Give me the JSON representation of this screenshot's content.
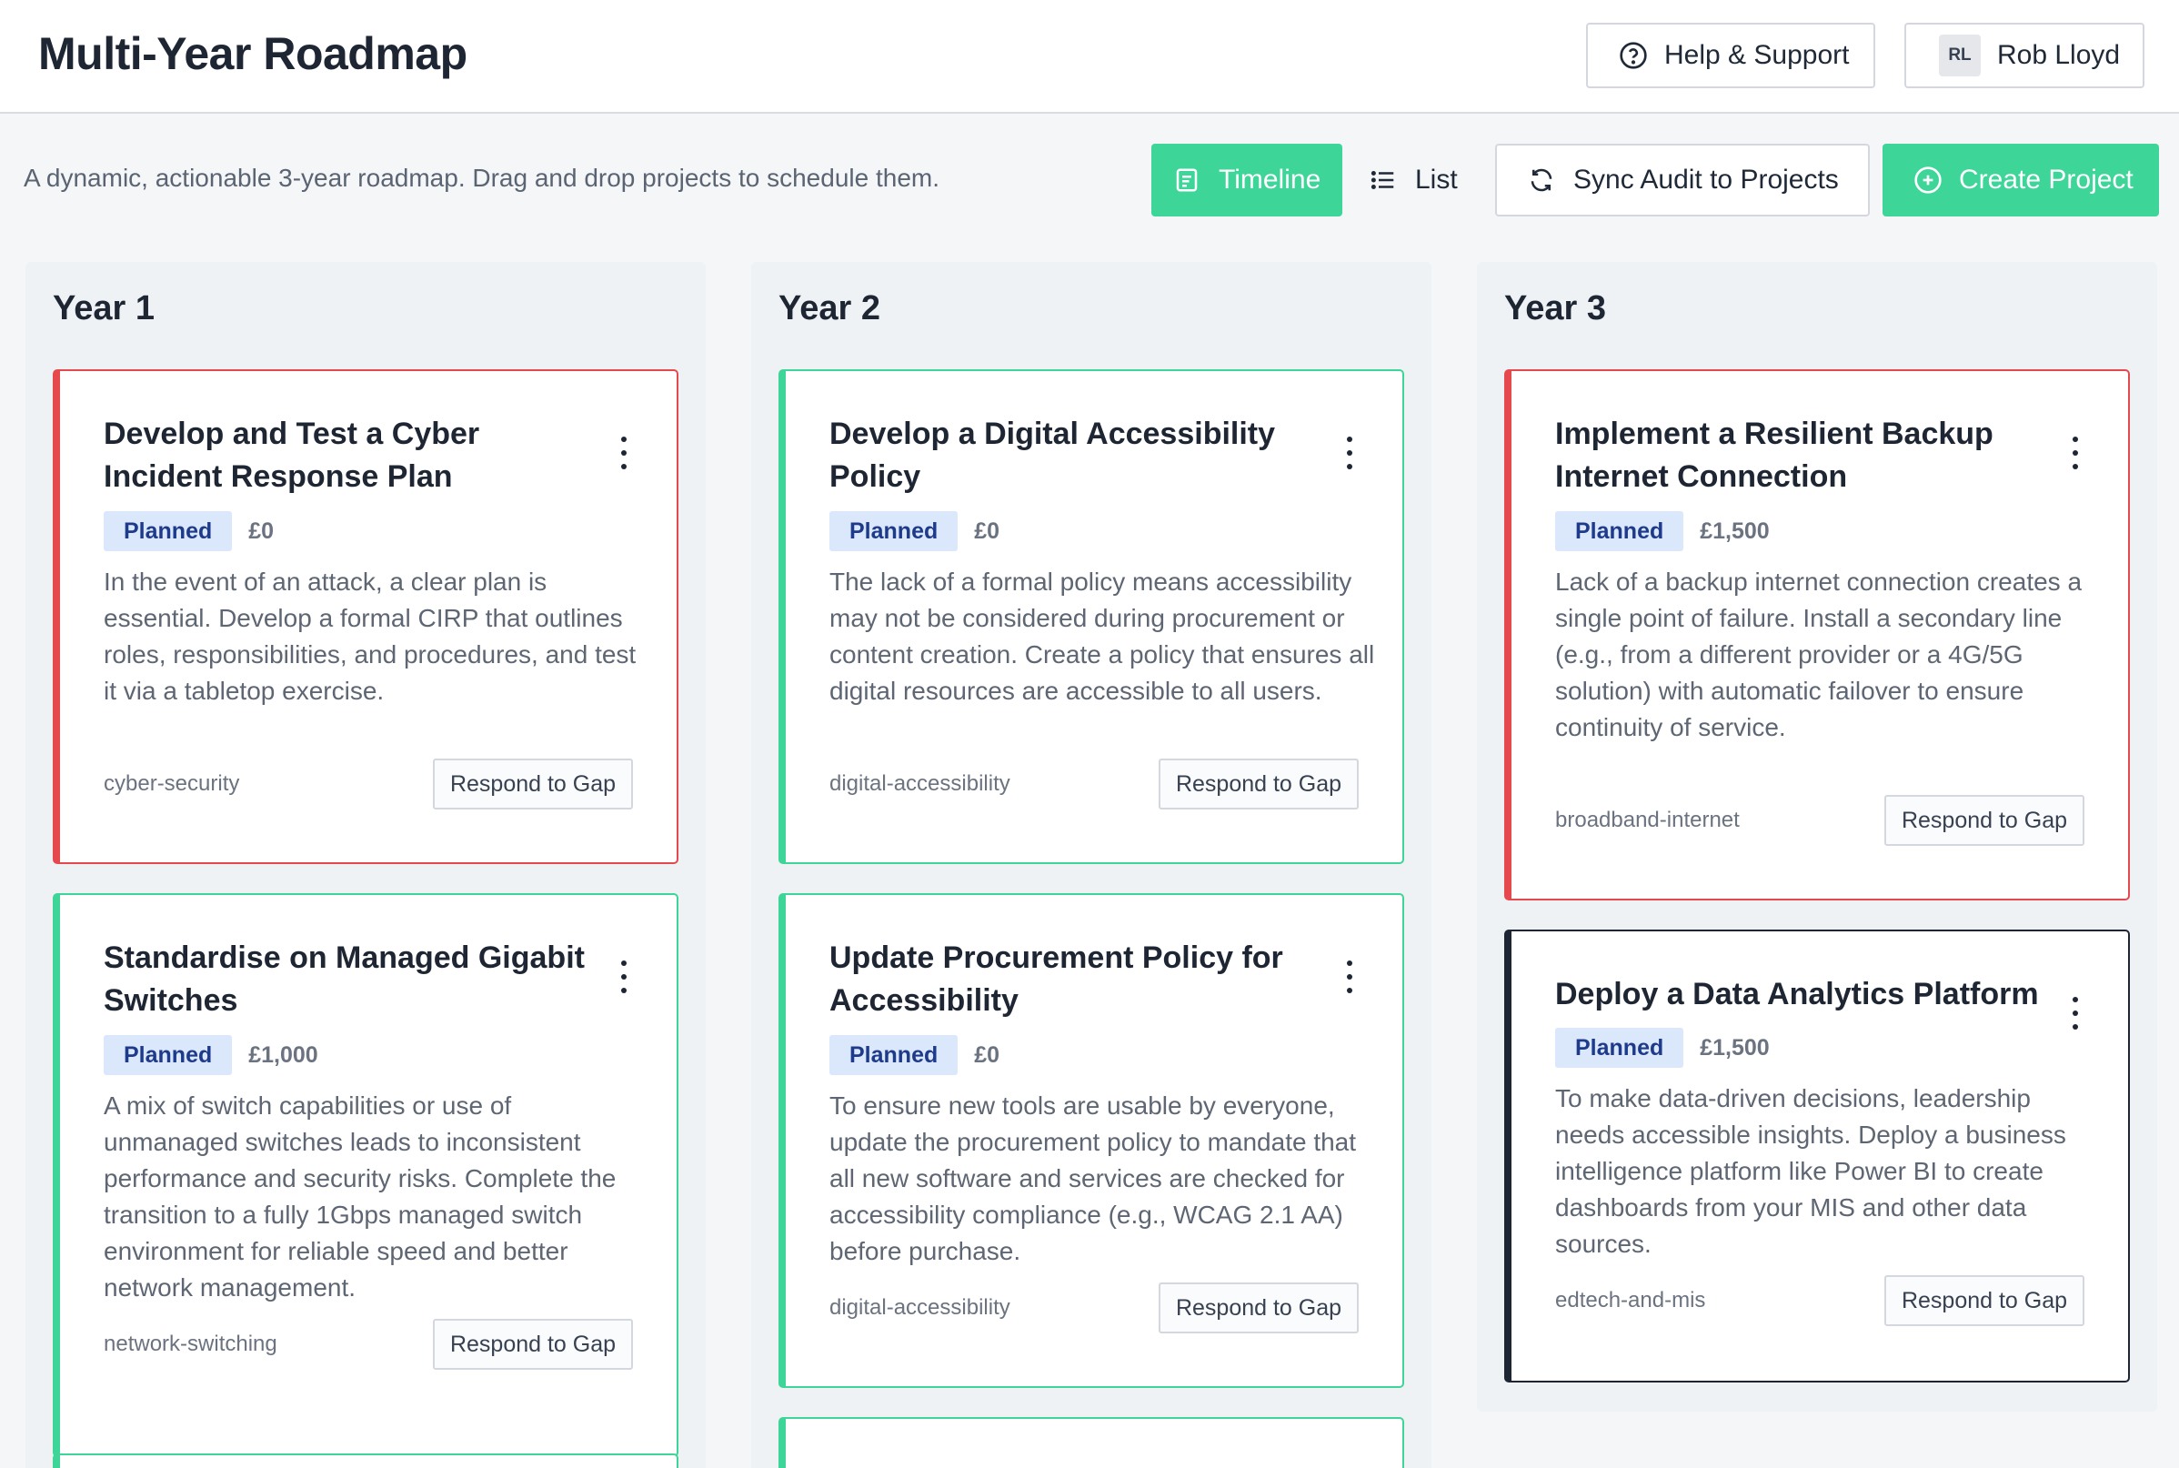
{
  "header": {
    "title": "Multi-Year Roadmap",
    "help_label": "Help & Support",
    "user_initials": "RL",
    "user_name": "Rob Lloyd"
  },
  "toolbar": {
    "description": "A dynamic, actionable 3-year roadmap. Drag and drop projects to schedule them.",
    "timeline_label": "Timeline",
    "list_label": "List",
    "sync_label": "Sync Audit to Projects",
    "create_label": "Create Project"
  },
  "colors": {
    "accent": "#3dd598",
    "high_priority": "#e5484d",
    "dark": "#1e2533",
    "badge_bg": "#dbe7fb"
  },
  "columns": [
    {
      "title": "Year 1",
      "cards": [
        {
          "title": "Develop and Test a Cyber Incident Response Plan",
          "status": "Planned",
          "cost": "£0",
          "description": "In the event of an attack, a clear plan is essential. Develop a formal CIRP that outlines roles, responsibilities, and procedures, and test it via a tabletop exercise.",
          "tag": "cyber-security",
          "action": "Respond to Gap"
        },
        {
          "title": "Standardise on Managed Gigabit Switches",
          "status": "Planned",
          "cost": "£1,000",
          "description": "A mix of switch capabilities or use of unmanaged switches leads to inconsistent performance and security risks. Complete the transition to a fully 1Gbps managed switch environment for reliable speed and better network management.",
          "tag": "network-switching",
          "action": "Respond to Gap"
        }
      ]
    },
    {
      "title": "Year 2",
      "cards": [
        {
          "title": "Develop a Digital Accessibility Policy",
          "status": "Planned",
          "cost": "£0",
          "description": "The lack of a formal policy means accessibility may not be considered during procurement or content creation. Create a policy that ensures all digital resources are accessible to all users.",
          "tag": "digital-accessibility",
          "action": "Respond to Gap"
        },
        {
          "title": "Update Procurement Policy for Accessibility",
          "status": "Planned",
          "cost": "£0",
          "description": "To ensure new tools are usable by everyone, update the procurement policy to mandate that all new software and services are checked for accessibility compliance (e.g., WCAG 2.1 AA) before purchase.",
          "tag": "digital-accessibility",
          "action": "Respond to Gap"
        }
      ]
    },
    {
      "title": "Year 3",
      "cards": [
        {
          "title": "Implement a Resilient Backup Internet Connection",
          "status": "Planned",
          "cost": "£1,500",
          "description": "Lack of a backup internet connection creates a single point of failure. Install a secondary line (e.g., from a different provider or a 4G/5G solution) with automatic failover to ensure continuity of service.",
          "tag": "broadband-internet",
          "action": "Respond to Gap"
        },
        {
          "title": "Deploy a Data Analytics Platform",
          "status": "Planned",
          "cost": "£1,500",
          "description": "To make data-driven decisions, leadership needs accessible insights. Deploy a business intelligence platform like Power BI to create dashboards from your MIS and other data sources.",
          "tag": "edtech-and-mis",
          "action": "Respond to Gap"
        }
      ]
    }
  ]
}
